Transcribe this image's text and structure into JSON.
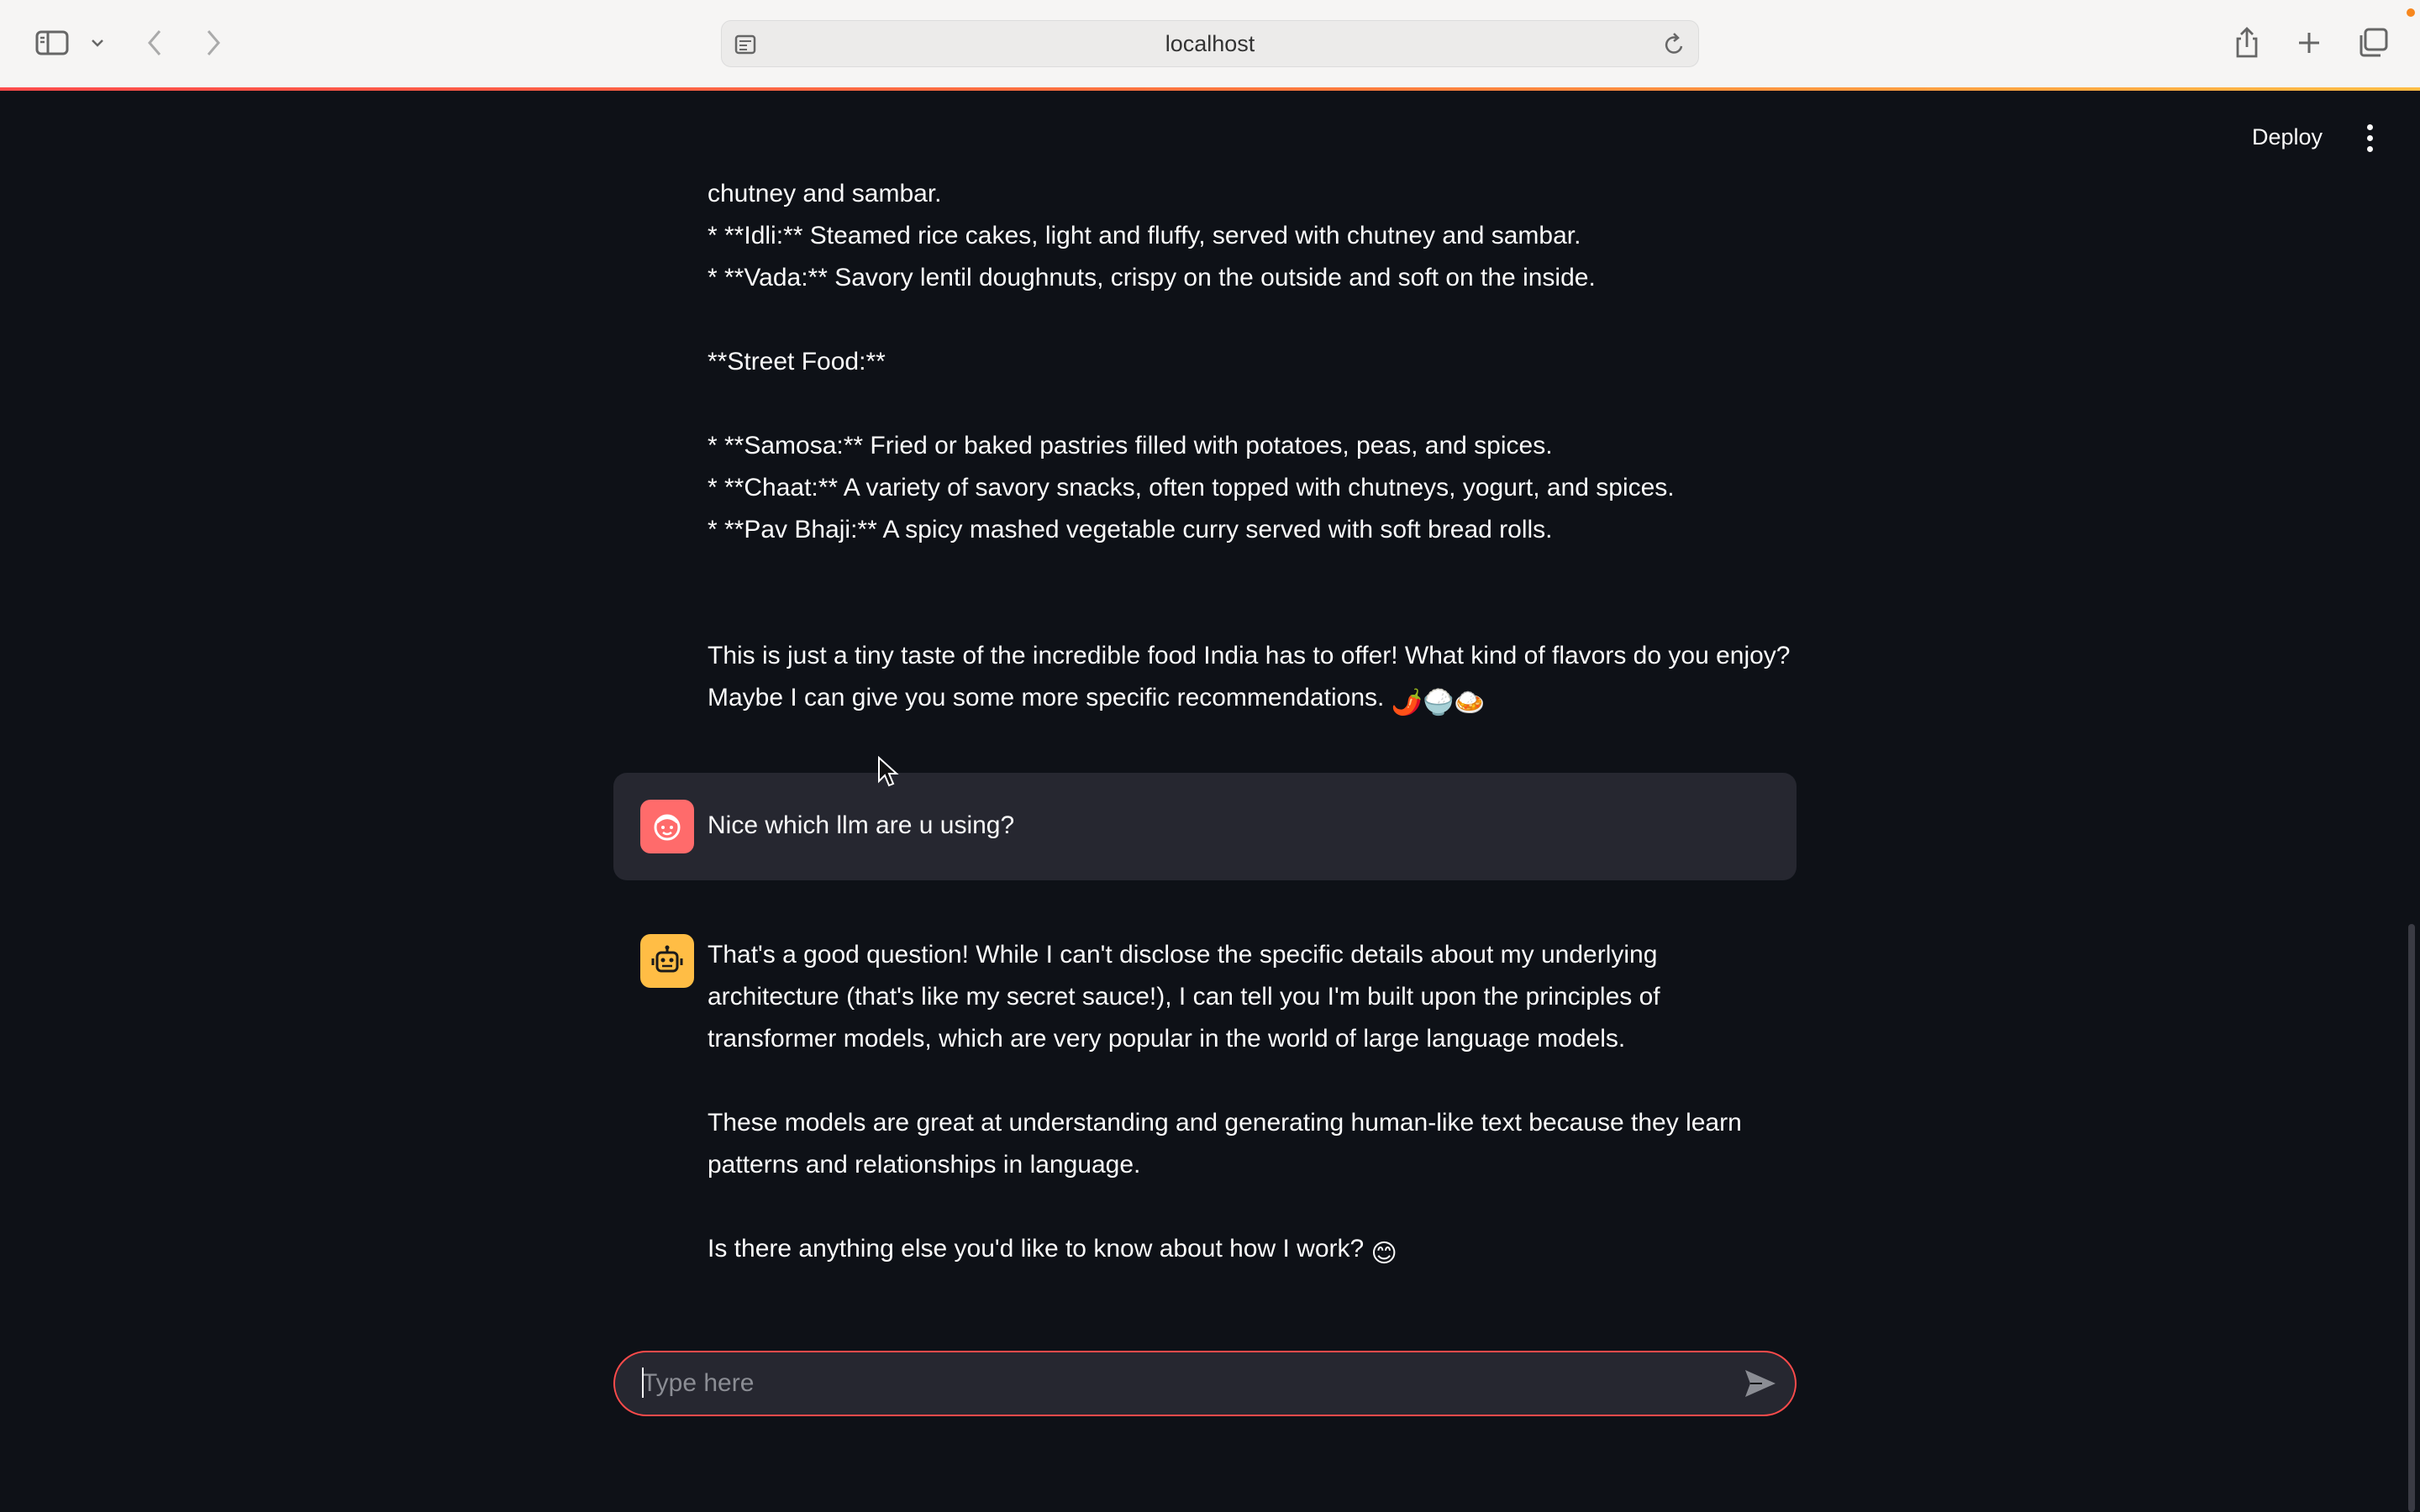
{
  "browser": {
    "url": "localhost"
  },
  "app_header": {
    "deploy_label": "Deploy"
  },
  "chat": {
    "assistant_prev_lines": [
      "chutney and sambar.",
      "* **Idli:** Steamed rice cakes, light and fluffy, served with chutney and sambar.",
      "* **Vada:** Savory lentil doughnuts, crispy on the outside and soft on the inside.",
      "**Street Food:**",
      "* **Samosa:** Fried or baked pastries filled with potatoes, peas, and spices.",
      "* **Chaat:** A variety of savory snacks, often topped with chutneys, yogurt, and spices.",
      "* **Pav Bhaji:** A spicy mashed vegetable curry served with soft bread rolls.",
      "This is just a tiny taste of the incredible food India has to offer! What kind of flavors do you enjoy?",
      "Maybe I can give you some more specific recommendations."
    ],
    "assistant_prev_emojis": "🌶️🍚🍛",
    "user_message": "Nice which llm are u using?",
    "assistant_reply_lines": [
      "That's a good question! While I can't disclose the specific details about my underlying",
      "architecture (that's like my secret sauce!), I can tell you I'm built upon the principles of",
      "transformer models, which are very popular in the world of large language models.",
      "These models are great at understanding and generating human-like text because they learn",
      "patterns and relationships in language.",
      "Is there anything else you'd like to know about how I work?"
    ],
    "assistant_reply_emoji": "😊"
  },
  "input": {
    "placeholder": "Type here",
    "value": ""
  },
  "colors": {
    "background": "#0e1117",
    "user_bubble": "#262730",
    "accent": "#ff4b4b",
    "user_avatar": "#ff6b6b",
    "bot_avatar": "#ffbd45"
  },
  "icons": {
    "sidebar_toggle": "sidebar-icon",
    "back": "chevron-left-icon",
    "forward": "chevron-right-icon",
    "share": "share-icon",
    "new_tab": "plus-icon",
    "tabs_overview": "tabs-icon",
    "reload": "reload-icon",
    "user_avatar": "user-face-icon",
    "bot_avatar": "robot-icon",
    "send": "send-icon",
    "menu": "more-vertical-icon"
  }
}
